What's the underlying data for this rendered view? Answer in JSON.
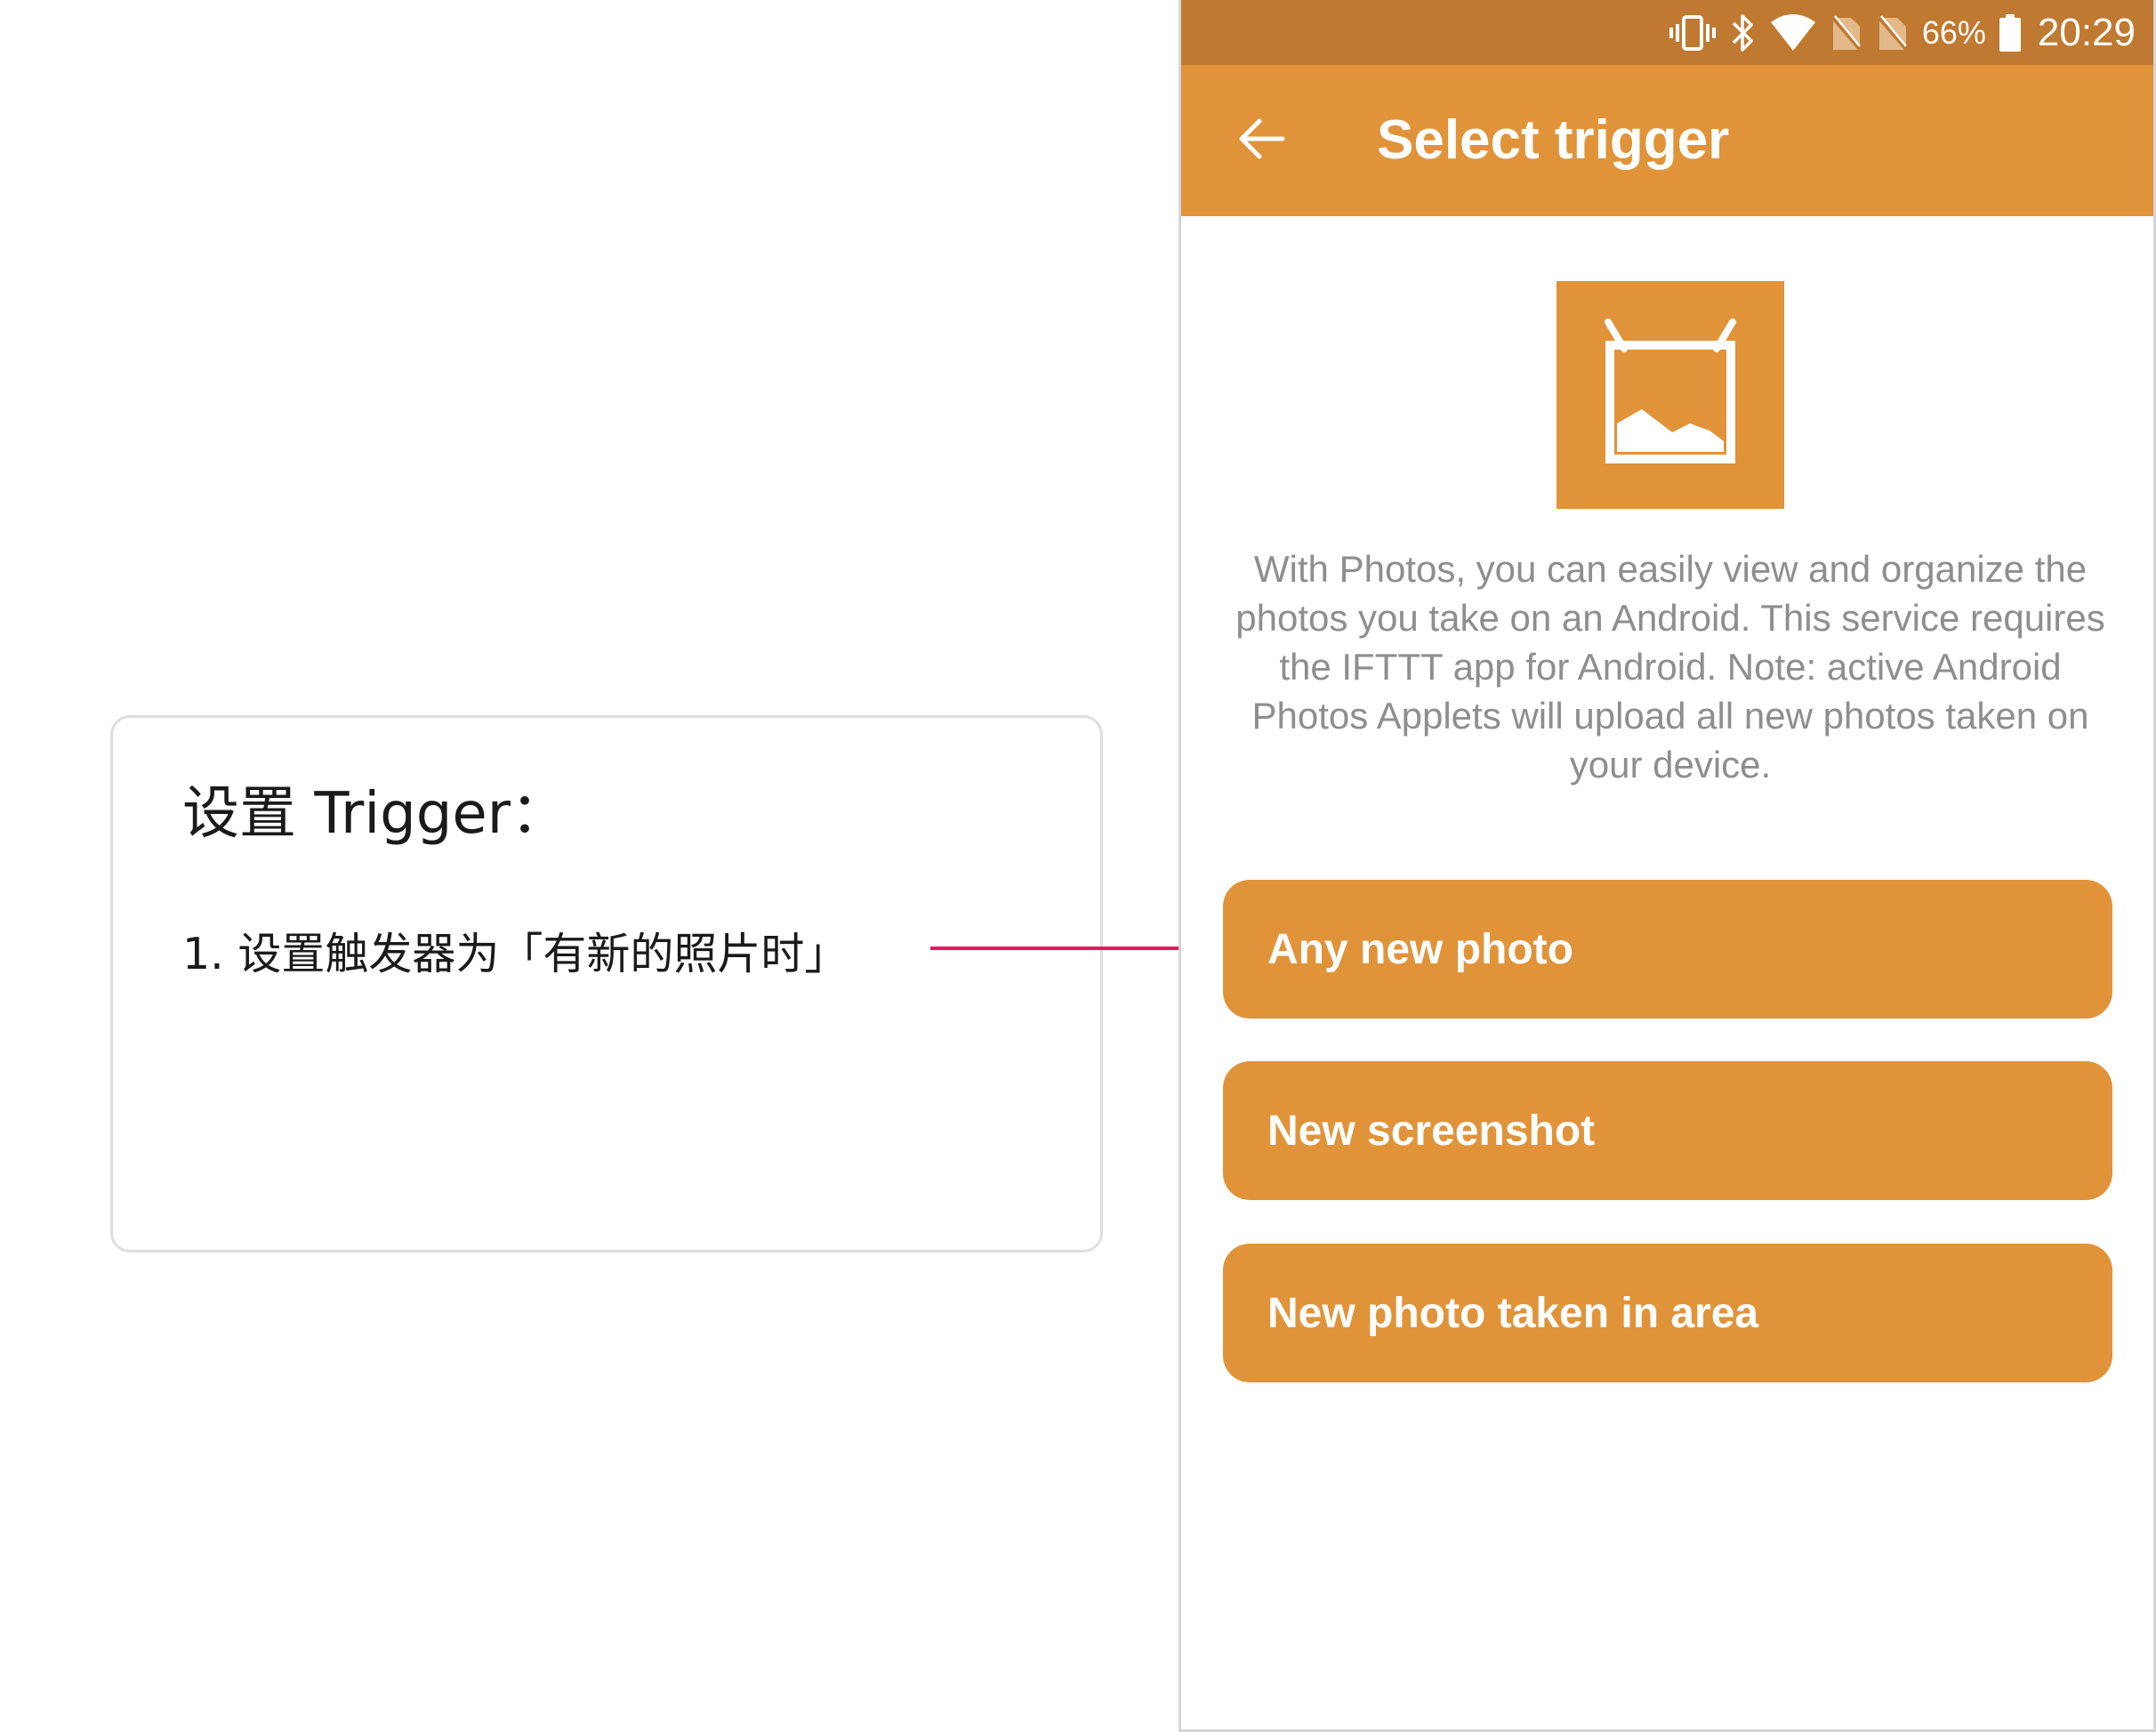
{
  "annotation": {
    "title": "设置 Trigger：",
    "step": "1. 设置触发器为「有新的照片时」",
    "connector_color": "#e8185c"
  },
  "status_bar": {
    "icons": [
      "vibrate-icon",
      "bluetooth-icon",
      "wifi-icon",
      "no-sim-icon",
      "no-sim-icon",
      "battery-icon"
    ],
    "battery_percent": "66%",
    "time": "20:29",
    "color": "#bf7930"
  },
  "app_bar": {
    "back_icon": "arrow-left-icon",
    "title": "Select trigger",
    "color": "#e09338"
  },
  "service": {
    "icon": "android-photos-icon",
    "description": "With Photos, you can easily view and organize the photos you take on an Android. This service requires the IFTTT app for Android. Note: active Android Photos Applets will upload all new photos taken on your device."
  },
  "triggers": [
    {
      "label": "Any new photo"
    },
    {
      "label": "New screenshot"
    },
    {
      "label": "New photo taken in area"
    }
  ],
  "colors": {
    "brand": "#e09338",
    "description_text": "#8e8e8e"
  }
}
